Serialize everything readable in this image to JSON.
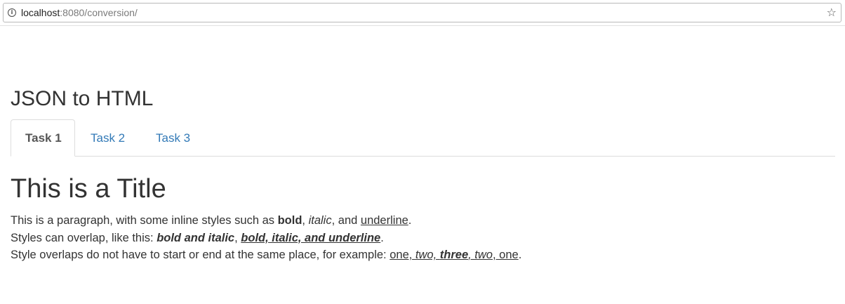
{
  "browser": {
    "url_host": "localhost",
    "url_rest": ":8080/conversion/",
    "info_icon": "info-icon",
    "bookmark_icon": "star-icon"
  },
  "page": {
    "title": "JSON to HTML",
    "tabs": [
      {
        "label": "Task 1",
        "active": true
      },
      {
        "label": "Task 2",
        "active": false
      },
      {
        "label": "Task 3",
        "active": false
      }
    ]
  },
  "content": {
    "title": "This is a Title",
    "line1": {
      "prefix": "This is a paragraph, with some inline styles such as ",
      "bold": "bold",
      "sep1": ", ",
      "italic": "italic",
      "sep2": ", and ",
      "underline": "underline",
      "suffix": "."
    },
    "line2": {
      "prefix": "Styles can overlap, like this: ",
      "bold_italic": "bold and italic",
      "sep": ", ",
      "bold_italic_underline": "bold, italic, and underline",
      "suffix": "."
    },
    "line3": {
      "prefix": "Style overlaps do not have to start or end at the same place, for example: ",
      "seg1": "one, ",
      "seg2": "two, ",
      "seg3": "three",
      "seg4": ", two",
      "seg5": ", one",
      "suffix": "."
    }
  },
  "colors": {
    "link": "#337ab7",
    "text": "#333333",
    "active_tab_text": "#555555",
    "border": "#dddddd"
  }
}
